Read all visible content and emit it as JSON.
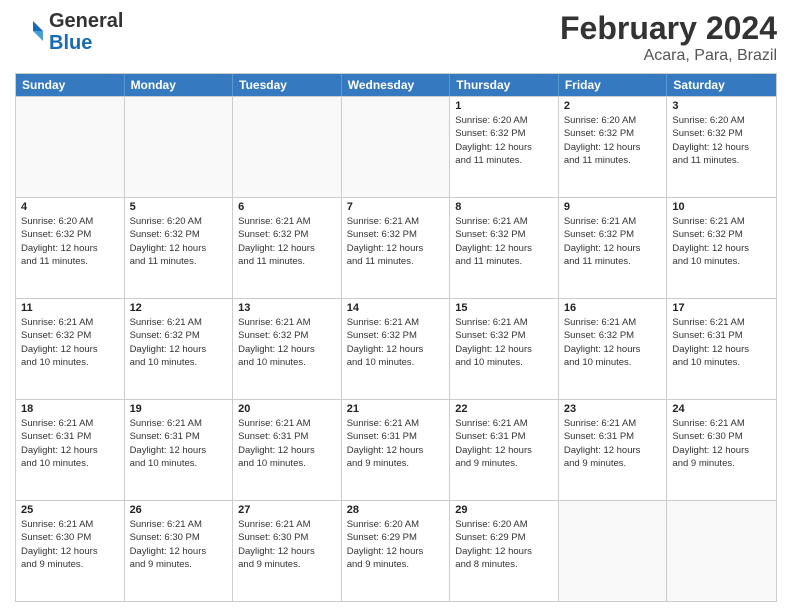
{
  "header": {
    "logo": {
      "general": "General",
      "blue": "Blue"
    },
    "title": "February 2024",
    "subtitle": "Acara, Para, Brazil"
  },
  "weekdays": [
    "Sunday",
    "Monday",
    "Tuesday",
    "Wednesday",
    "Thursday",
    "Friday",
    "Saturday"
  ],
  "rows": [
    [
      {
        "day": "",
        "info": ""
      },
      {
        "day": "",
        "info": ""
      },
      {
        "day": "",
        "info": ""
      },
      {
        "day": "",
        "info": ""
      },
      {
        "day": "1",
        "info": "Sunrise: 6:20 AM\nSunset: 6:32 PM\nDaylight: 12 hours\nand 11 minutes."
      },
      {
        "day": "2",
        "info": "Sunrise: 6:20 AM\nSunset: 6:32 PM\nDaylight: 12 hours\nand 11 minutes."
      },
      {
        "day": "3",
        "info": "Sunrise: 6:20 AM\nSunset: 6:32 PM\nDaylight: 12 hours\nand 11 minutes."
      }
    ],
    [
      {
        "day": "4",
        "info": "Sunrise: 6:20 AM\nSunset: 6:32 PM\nDaylight: 12 hours\nand 11 minutes."
      },
      {
        "day": "5",
        "info": "Sunrise: 6:20 AM\nSunset: 6:32 PM\nDaylight: 12 hours\nand 11 minutes."
      },
      {
        "day": "6",
        "info": "Sunrise: 6:21 AM\nSunset: 6:32 PM\nDaylight: 12 hours\nand 11 minutes."
      },
      {
        "day": "7",
        "info": "Sunrise: 6:21 AM\nSunset: 6:32 PM\nDaylight: 12 hours\nand 11 minutes."
      },
      {
        "day": "8",
        "info": "Sunrise: 6:21 AM\nSunset: 6:32 PM\nDaylight: 12 hours\nand 11 minutes."
      },
      {
        "day": "9",
        "info": "Sunrise: 6:21 AM\nSunset: 6:32 PM\nDaylight: 12 hours\nand 11 minutes."
      },
      {
        "day": "10",
        "info": "Sunrise: 6:21 AM\nSunset: 6:32 PM\nDaylight: 12 hours\nand 10 minutes."
      }
    ],
    [
      {
        "day": "11",
        "info": "Sunrise: 6:21 AM\nSunset: 6:32 PM\nDaylight: 12 hours\nand 10 minutes."
      },
      {
        "day": "12",
        "info": "Sunrise: 6:21 AM\nSunset: 6:32 PM\nDaylight: 12 hours\nand 10 minutes."
      },
      {
        "day": "13",
        "info": "Sunrise: 6:21 AM\nSunset: 6:32 PM\nDaylight: 12 hours\nand 10 minutes."
      },
      {
        "day": "14",
        "info": "Sunrise: 6:21 AM\nSunset: 6:32 PM\nDaylight: 12 hours\nand 10 minutes."
      },
      {
        "day": "15",
        "info": "Sunrise: 6:21 AM\nSunset: 6:32 PM\nDaylight: 12 hours\nand 10 minutes."
      },
      {
        "day": "16",
        "info": "Sunrise: 6:21 AM\nSunset: 6:32 PM\nDaylight: 12 hours\nand 10 minutes."
      },
      {
        "day": "17",
        "info": "Sunrise: 6:21 AM\nSunset: 6:31 PM\nDaylight: 12 hours\nand 10 minutes."
      }
    ],
    [
      {
        "day": "18",
        "info": "Sunrise: 6:21 AM\nSunset: 6:31 PM\nDaylight: 12 hours\nand 10 minutes."
      },
      {
        "day": "19",
        "info": "Sunrise: 6:21 AM\nSunset: 6:31 PM\nDaylight: 12 hours\nand 10 minutes."
      },
      {
        "day": "20",
        "info": "Sunrise: 6:21 AM\nSunset: 6:31 PM\nDaylight: 12 hours\nand 10 minutes."
      },
      {
        "day": "21",
        "info": "Sunrise: 6:21 AM\nSunset: 6:31 PM\nDaylight: 12 hours\nand 9 minutes."
      },
      {
        "day": "22",
        "info": "Sunrise: 6:21 AM\nSunset: 6:31 PM\nDaylight: 12 hours\nand 9 minutes."
      },
      {
        "day": "23",
        "info": "Sunrise: 6:21 AM\nSunset: 6:31 PM\nDaylight: 12 hours\nand 9 minutes."
      },
      {
        "day": "24",
        "info": "Sunrise: 6:21 AM\nSunset: 6:30 PM\nDaylight: 12 hours\nand 9 minutes."
      }
    ],
    [
      {
        "day": "25",
        "info": "Sunrise: 6:21 AM\nSunset: 6:30 PM\nDaylight: 12 hours\nand 9 minutes."
      },
      {
        "day": "26",
        "info": "Sunrise: 6:21 AM\nSunset: 6:30 PM\nDaylight: 12 hours\nand 9 minutes."
      },
      {
        "day": "27",
        "info": "Sunrise: 6:21 AM\nSunset: 6:30 PM\nDaylight: 12 hours\nand 9 minutes."
      },
      {
        "day": "28",
        "info": "Sunrise: 6:20 AM\nSunset: 6:29 PM\nDaylight: 12 hours\nand 9 minutes."
      },
      {
        "day": "29",
        "info": "Sunrise: 6:20 AM\nSunset: 6:29 PM\nDaylight: 12 hours\nand 8 minutes."
      },
      {
        "day": "",
        "info": ""
      },
      {
        "day": "",
        "info": ""
      }
    ]
  ]
}
